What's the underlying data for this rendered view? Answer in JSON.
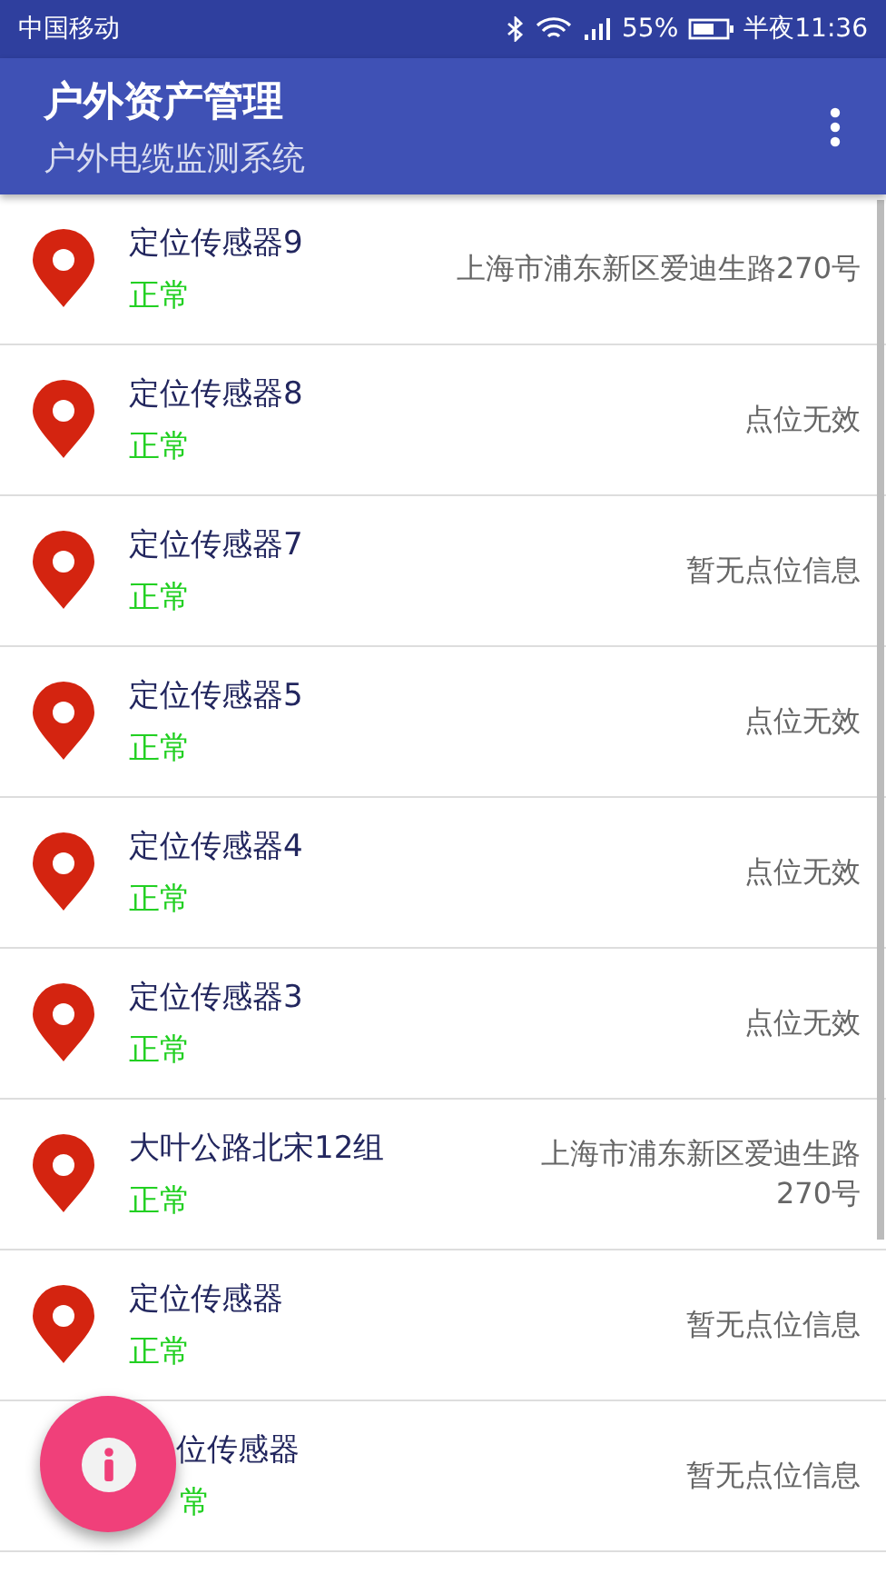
{
  "status_bar": {
    "carrier": "中国移动",
    "battery": "55%",
    "time": "半夜11:36"
  },
  "app_bar": {
    "title": "户外资产管理",
    "subtitle": "户外电缆监测系统"
  },
  "sensors": [
    {
      "name": "定位传感器9",
      "status": "正常",
      "location": "上海市浦东新区爱迪生路270号"
    },
    {
      "name": "定位传感器8",
      "status": "正常",
      "location": "点位无效"
    },
    {
      "name": "定位传感器7",
      "status": "正常",
      "location": "暂无点位信息"
    },
    {
      "name": "定位传感器5",
      "status": "正常",
      "location": "点位无效"
    },
    {
      "name": "定位传感器4",
      "status": "正常",
      "location": "点位无效"
    },
    {
      "name": "定位传感器3",
      "status": "正常",
      "location": "点位无效"
    },
    {
      "name": "大叶公路北宋12组",
      "status": "正常",
      "location": "上海市浦东新区爱迪生路\n270号"
    },
    {
      "name": "定位传感器",
      "status": "正常",
      "location": "暂无点位信息"
    },
    {
      "name": "位传感器",
      "status": "常",
      "location": "暂无点位信息",
      "partly_hidden": true
    }
  ]
}
